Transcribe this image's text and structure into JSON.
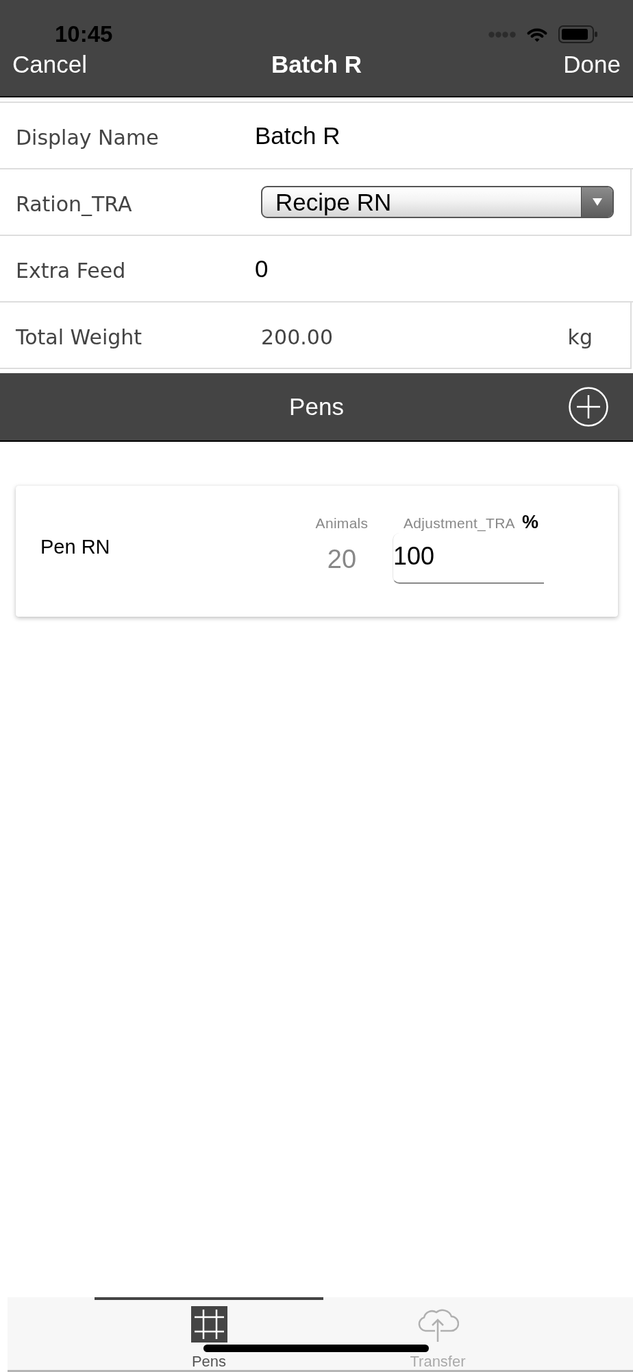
{
  "status_bar": {
    "time": "10:45"
  },
  "nav_bar": {
    "cancel": "Cancel",
    "title": "Batch R",
    "done": "Done"
  },
  "form": {
    "rows": [
      {
        "kind": "text",
        "label": "Display Name",
        "value": "Batch R"
      },
      {
        "kind": "dropdown",
        "label": "Ration_TRA",
        "value": "Recipe RN"
      },
      {
        "kind": "text",
        "label": "Extra Feed",
        "value": "0"
      },
      {
        "kind": "readout",
        "label": "Total Weight",
        "value": "200.00",
        "unit": "kg"
      }
    ]
  },
  "pens_section": {
    "title": "Pens",
    "pens": [
      {
        "name": "Pen RN",
        "animals_label": "Animals",
        "animals": "20",
        "adjustment_label": "Adjustment_TRA",
        "adjustment_unit": "%",
        "adjustment": "100"
      }
    ]
  },
  "tab_bar": {
    "tabs": [
      {
        "label": "Pens",
        "selected": true
      },
      {
        "label": "Transfer",
        "selected": false
      }
    ]
  }
}
